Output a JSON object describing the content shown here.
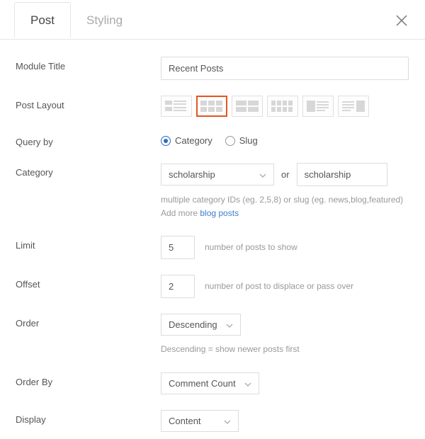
{
  "tabs": {
    "post": "Post",
    "styling": "Styling"
  },
  "labels": {
    "module_title": "Module Title",
    "post_layout": "Post Layout",
    "query_by": "Query by",
    "category": "Category",
    "limit": "Limit",
    "offset": "Offset",
    "order": "Order",
    "order_by": "Order By",
    "display": "Display"
  },
  "values": {
    "module_title": "Recent Posts",
    "query_by": "Category",
    "category_select": "scholarship",
    "category_or": "or",
    "category_text": "scholarship",
    "limit": "5",
    "offset": "2",
    "order": "Descending",
    "order_by": "Comment Count",
    "display": "Content"
  },
  "query_by_options": {
    "category": "Category",
    "slug": "Slug"
  },
  "hints": {
    "category": "multiple category IDs (eg. 2,5,8) or slug (eg. news,blog,featured)",
    "add_more_prefix": "Add more ",
    "add_more_link": "blog posts",
    "limit": "number of posts to show",
    "offset": "number of post to displace or pass over",
    "order": "Descending = show newer posts first"
  }
}
